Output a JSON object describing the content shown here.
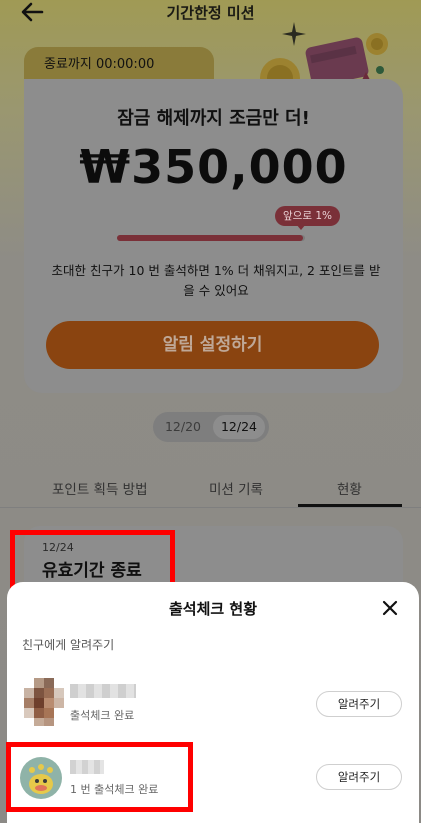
{
  "header": {
    "title": "기간한정 미션"
  },
  "mission_card": {
    "timer_label": "종료까지 00:00:00",
    "heading": "잠금 해제까지 조금만 더!",
    "amount": "₩350,000",
    "remaining_badge": "앞으로 1%",
    "progress_fraction": 0.99,
    "description": "초대한 친구가 10 번 출석하면 1% 더 채워지고, 2 포인트를 받을 수 있어요",
    "alarm_button_label": "알림 설정하기"
  },
  "date_toggle": {
    "options": [
      "12/20",
      "12/24"
    ],
    "selected": "12/24"
  },
  "tabs": [
    {
      "label": "포인트 획득 방법"
    },
    {
      "label": "미션 기록"
    },
    {
      "label": "현황"
    }
  ],
  "status_card": {
    "date": "12/24",
    "status": "유효기간 종료"
  },
  "sheet": {
    "title": "출석체크 현황",
    "section_label": "친구에게 알려주기",
    "friends": [
      {
        "status": "출석체크 완료",
        "button_label": "알려주기"
      },
      {
        "status": "1 번 출석체크 완료",
        "button_label": "알려주기"
      }
    ]
  },
  "colors": {
    "highlight_box": "#ff0000",
    "accent_orange": "#e8701a",
    "badge_red": "#c94a57"
  }
}
